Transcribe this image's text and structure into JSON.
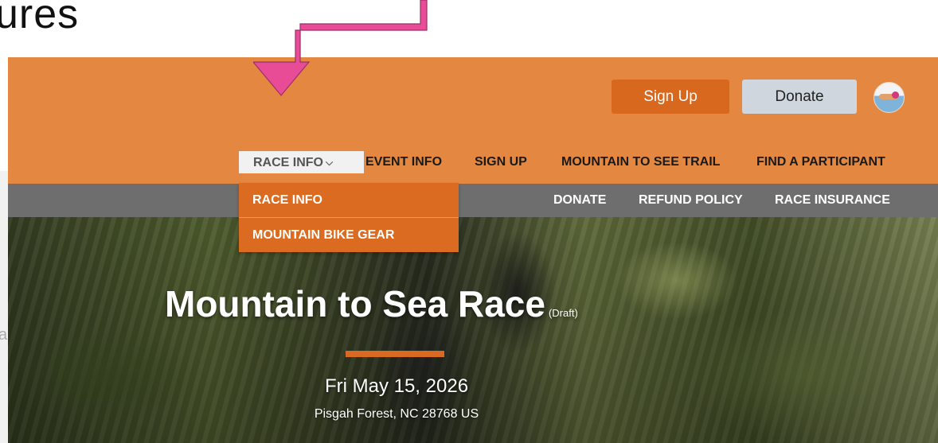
{
  "fragment_text": "ures",
  "left_fragment": "a",
  "header": {
    "signup_button": "Sign Up",
    "donate_button": "Donate"
  },
  "nav_primary": [
    {
      "label": "RACE INFO"
    },
    {
      "label": "EVENT INFO"
    },
    {
      "label": "SIGN UP"
    },
    {
      "label": "MOUNTAIN TO SEE TRAIL"
    },
    {
      "label": "FIND A PARTICIPANT"
    }
  ],
  "nav_secondary": [
    {
      "label": "DONATE"
    },
    {
      "label": "REFUND POLICY"
    },
    {
      "label": "RACE INSURANCE"
    }
  ],
  "dropdown": {
    "items": [
      {
        "label": "RACE INFO"
      },
      {
        "label": "MOUNTAIN BIKE GEAR"
      }
    ]
  },
  "hero": {
    "title": "Mountain to Sea Race",
    "draft_tag": "(Draft)",
    "date": "Fri May 15, 2026",
    "location": "Pisgah Forest, NC 28768 US"
  },
  "colors": {
    "header_orange": "#e48841",
    "button_orange": "#d9681f",
    "dropdown_orange": "#db6b20",
    "nav_gray": "#6e6e6e",
    "arrow_pink": "#e84c97"
  },
  "icons": {
    "chevron": "chevron-down-icon",
    "arrow": "annotation-arrow-icon",
    "avatar": "user-avatar"
  }
}
